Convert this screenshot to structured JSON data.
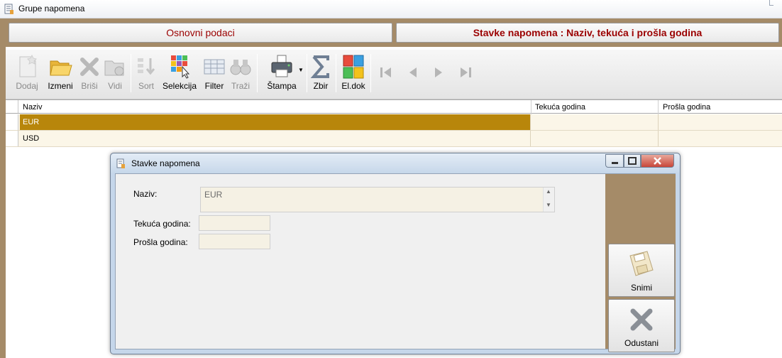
{
  "window": {
    "title": "Grupe napomena"
  },
  "tabs": {
    "osnovni": "Osnovni podaci",
    "stavke": "Stavke napomena : Naziv, tekuća i prošla godina"
  },
  "toolbar": {
    "dodaj": "Dodaj",
    "izmeni": "Izmeni",
    "brisi": "Briši",
    "vidi": "Vidi",
    "sort": "Sort",
    "selekcija": "Selekcija",
    "filter": "Filter",
    "trazi": "Traži",
    "stampa": "Štampa",
    "zbir": "Zbir",
    "eldok": "El.dok"
  },
  "grid": {
    "columns": {
      "naziv": "Naziv",
      "tekuca": "Tekuća godina",
      "prosla": "Prošla godina"
    },
    "rows": [
      {
        "naziv": "EUR",
        "tekuca": "",
        "prosla": "",
        "selected": true
      },
      {
        "naziv": "USD",
        "tekuca": "",
        "prosla": "",
        "selected": false
      }
    ]
  },
  "dialog": {
    "title": "Stavke napomena",
    "labels": {
      "naziv": "Naziv:",
      "tekuca": "Tekuća godina:",
      "prosla": "Prošla godina:"
    },
    "values": {
      "naziv": "EUR",
      "tekuca": "",
      "prosla": ""
    },
    "buttons": {
      "snimi": "Snimi",
      "odustani": "Odustani"
    }
  },
  "colors": {
    "accent_dark_red": "#9b0000",
    "frame_tan": "#a58b68",
    "selected_row": "#b8860b",
    "row_bg": "#fbf6e8"
  }
}
